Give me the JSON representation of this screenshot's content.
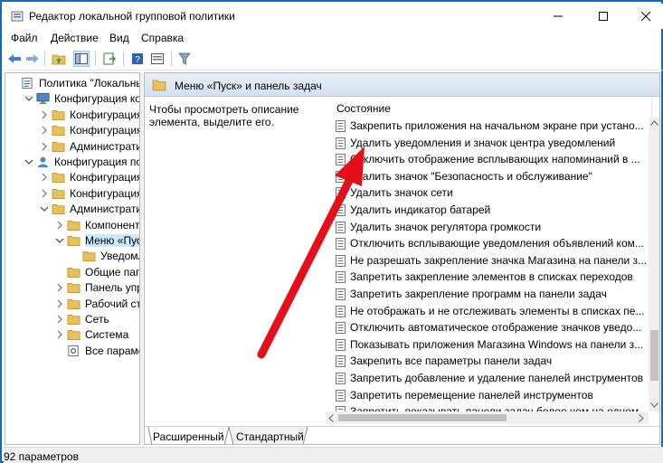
{
  "window": {
    "title": "Редактор локальной групповой политики",
    "accent": "#1a66b8",
    "controls": [
      "minimize-icon",
      "maximize-icon",
      "close-icon"
    ]
  },
  "menu": {
    "file": "Файл",
    "action": "Действие",
    "view": "Вид",
    "help": "Справка"
  },
  "toolbar": {
    "buttons": [
      "back-arrow-icon",
      "forward-arrow-icon",
      "up-folder-icon",
      "show-hide-tree-icon",
      "export-list-icon",
      "help-icon",
      "properties-icon",
      "filter-icon"
    ]
  },
  "tree": {
    "items": [
      {
        "label": "Политика \"Локальный"
      },
      {
        "label": "Конфигурация комп"
      },
      {
        "label": "Конфигурация п"
      },
      {
        "label": "Конфигурация W"
      },
      {
        "label": "Административ"
      },
      {
        "label": "Конфигурация поль"
      },
      {
        "label": "Конфигурация п"
      },
      {
        "label": "Конфигурация W"
      },
      {
        "label": "Административ"
      },
      {
        "label": "Компоненты"
      },
      {
        "label": "Меню «Пуск"
      },
      {
        "label": "Уведомле"
      },
      {
        "label": "Общие папк"
      },
      {
        "label": "Панель упра"
      },
      {
        "label": "Рабочий сто"
      },
      {
        "label": "Сеть"
      },
      {
        "label": "Система"
      },
      {
        "label": "Все параметр"
      }
    ]
  },
  "details": {
    "header": "Меню «Пуск» и панель задач",
    "description": "Чтобы просмотреть описание элемента, выделите его.",
    "column_state": "Состояние",
    "policies": [
      "Закрепить приложения на начальном экране при устано...",
      "Удалить уведомления и значок центра уведомлений",
      "Отключить отображение всплывающих напоминаний в ...",
      "Удалить значок \"Безопасность и обслуживание\"",
      "Удалить значок сети",
      "Удалить индикатор батарей",
      "Удалить значок регулятора громкости",
      "Отключить всплывающие уведомления объявлений ком...",
      "Не разрешать закрепление значка Магазина на панели з...",
      "Запретить закрепление элементов в списках переходов",
      "Запретить закрепление программ на панели задач",
      "Не отображать и не отслеживать элементы в списках пе...",
      "Отключить автоматическое отображение значков уведо...",
      "Показывать приложения Магазина Windows на панели з...",
      "Закрепить все параметры панели задач",
      "Запретить добавление и удаление панелей инструментов",
      "Запретить перемещение панелей инструментов",
      "Запретить показывать панели задач более чем на одном ..."
    ]
  },
  "tabs": {
    "extended": "Расширенный",
    "standard": "Стандартный"
  },
  "status": {
    "text": "92 параметров"
  },
  "colors": {
    "folder": "#e8c15a",
    "selection": "#cce8ff",
    "header_bg": "#dce6f4",
    "annotation_arrow": "#e3101a"
  }
}
